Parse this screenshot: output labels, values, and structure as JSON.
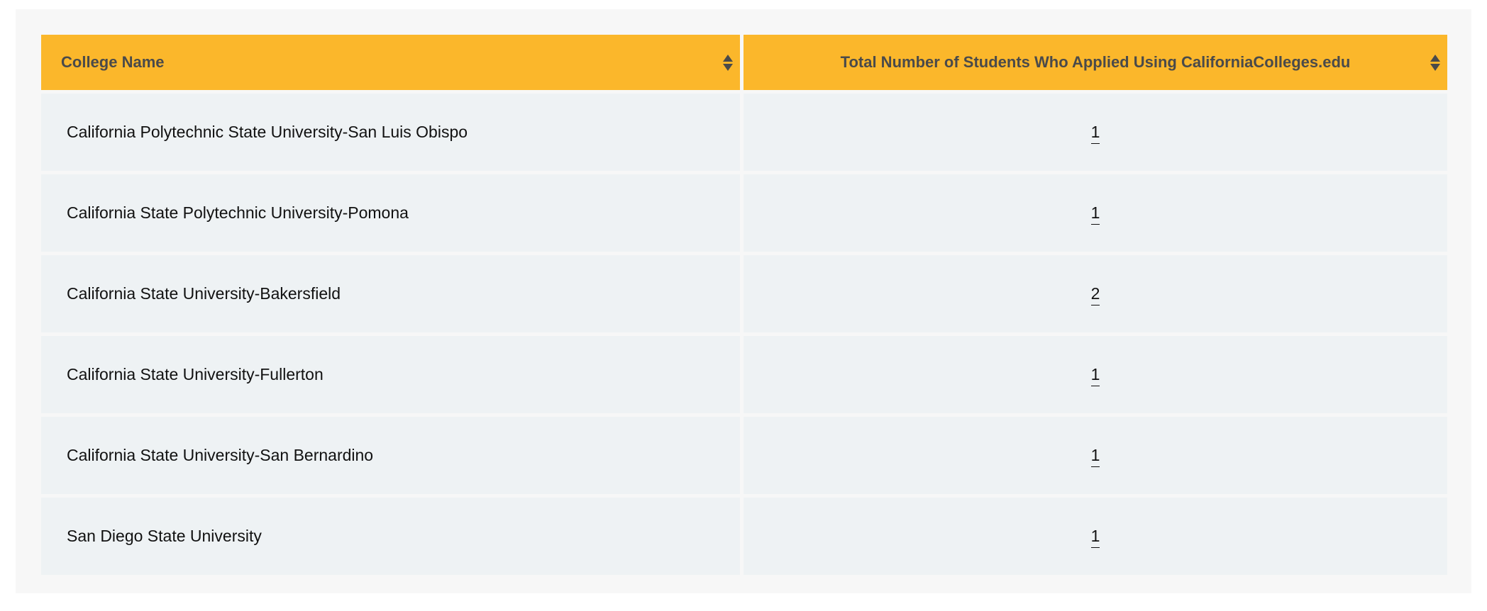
{
  "table": {
    "headers": {
      "college_name": "College Name",
      "total_applied": "Total Number of Students Who Applied Using CaliforniaColleges.edu"
    },
    "rows": [
      {
        "college": "California Polytechnic State University-San Luis Obispo",
        "count": "1"
      },
      {
        "college": "California State Polytechnic University-Pomona",
        "count": "1"
      },
      {
        "college": "California State University-Bakersfield",
        "count": "2"
      },
      {
        "college": "California State University-Fullerton",
        "count": "1"
      },
      {
        "college": "California State University-San Bernardino",
        "count": "1"
      },
      {
        "college": "San Diego State University",
        "count": "1"
      }
    ]
  },
  "icons": {
    "sort": "sort-icon"
  },
  "colors": {
    "header_bg": "#fbb72b",
    "row_bg": "#eef2f4",
    "panel_bg": "#f7f7f7"
  }
}
